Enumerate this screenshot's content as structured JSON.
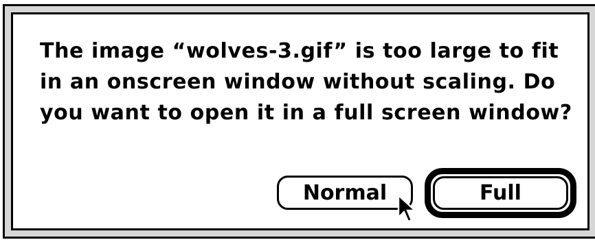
{
  "dialog": {
    "message": "The image “wolves-3.gif” is too large to fit in an onscreen window without scaling.  Do you want to open it in a full screen window?",
    "buttons": {
      "normal_label": "Normal",
      "full_label": "Full"
    },
    "default_button": "Full"
  },
  "cursor": {
    "icon": "arrow-pointer-icon"
  },
  "colors": {
    "text": "#000000",
    "background": "#ffffff",
    "frame_band": "#d6d6d6"
  }
}
